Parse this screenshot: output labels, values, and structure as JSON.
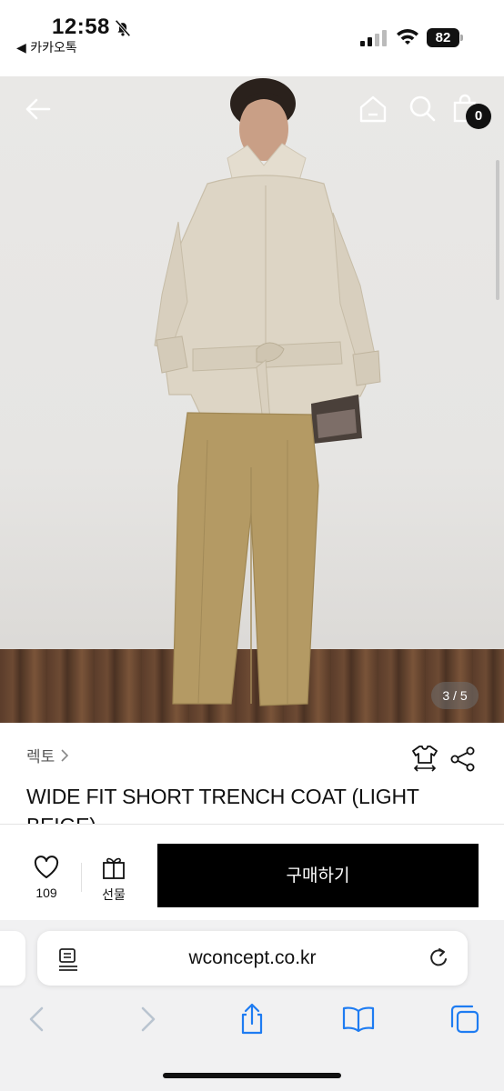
{
  "status_bar": {
    "time": "12:58",
    "back_app": "◀ 카카오톡",
    "battery": "82"
  },
  "header": {
    "cart_count": "0"
  },
  "gallery": {
    "pager": "3 / 5"
  },
  "product": {
    "brand": "렉토",
    "title": "WIDE FIT SHORT TRENCH COAT (LIGHT BEIGE)"
  },
  "actions": {
    "like_count": "109",
    "gift_label": "선물",
    "buy_label": "구매하기"
  },
  "browser": {
    "url": "wconcept.co.kr"
  },
  "colors": {
    "accent": "#000000",
    "coat": "#ddd5c5",
    "trousers": "#b49a64",
    "floor": "#5b3d2b"
  }
}
